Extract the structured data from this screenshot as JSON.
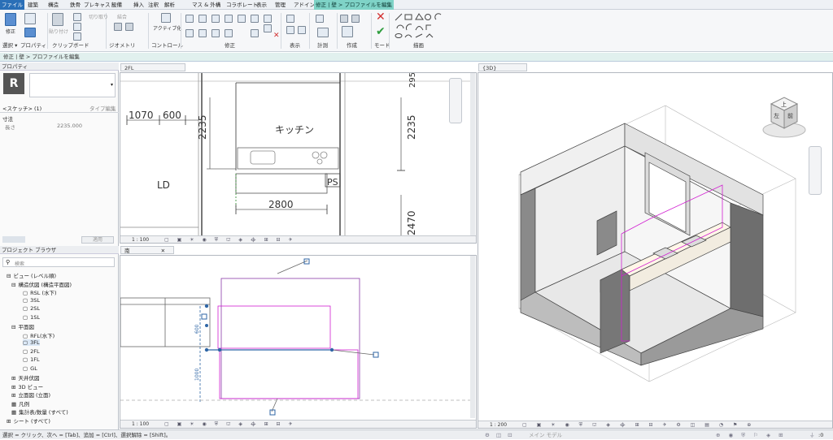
{
  "tabs": [
    "ファイル",
    "建築",
    "構造",
    "鉄骨",
    "プレキャスト",
    "設備",
    "挿入",
    "注釈",
    "解析",
    "マス & 外構",
    "コラボレート",
    "表示",
    "管理",
    "アドイン",
    "修正 | 壁 > プロファイルを編集"
  ],
  "ribbon": {
    "modify_label": "修正",
    "select_label": "選択 ▾",
    "properties_label": "プロパティ",
    "clipboard_label": "クリップボード",
    "geometry_label": "ジオメトリ",
    "control_label": "コントロール",
    "activate_label": "アクティブ化",
    "modify_group_label": "修正",
    "view_label": "表示",
    "measure_label": "計測",
    "create_label": "作成",
    "mode_label": "モード",
    "draw_label": "描画",
    "paste_label": "貼り付け",
    "cut_label": "切り取り",
    "join_label": "結合"
  },
  "optbar": {
    "text": "修正 | 壁 > プロファイルを編集"
  },
  "properties": {
    "title": "プロパティ",
    "type_name": "<スケッチ> (1)",
    "edit_type": "タイプ編集",
    "section": "寸法",
    "param_name": "長さ",
    "param_value": "2235.000",
    "apply": "適用"
  },
  "browser": {
    "title": "プロジェクト ブラウザ",
    "search_placeholder": "検索",
    "items": [
      {
        "label": "ビュー (レベル順)"
      },
      {
        "label": "構造伏図 (構造平面図)"
      },
      {
        "label": "RSL (水下)"
      },
      {
        "label": "3SL"
      },
      {
        "label": "2SL"
      },
      {
        "label": "1SL"
      },
      {
        "label": "平面図"
      },
      {
        "label": "RFL(水下)"
      },
      {
        "label": "3FL"
      },
      {
        "label": "2FL"
      },
      {
        "label": "1FL"
      },
      {
        "label": "GL"
      },
      {
        "label": "天井伏図"
      },
      {
        "label": "3D ビュー"
      },
      {
        "label": "立面図 (立面)"
      },
      {
        "label": "凡例"
      },
      {
        "label": "集計表/数量 (すべて)"
      },
      {
        "label": "シート (すべて)"
      }
    ]
  },
  "views": {
    "plan_tab": "2FL",
    "plan_scale": "1 : 100",
    "elev_tab": "南",
    "elev_scale": "1 : 100",
    "threed_tab": "{3D}",
    "threed_scale": "1 : 200"
  },
  "plan": {
    "dims": [
      "1070",
      "600",
      "2235",
      "2235",
      "2800",
      "2470",
      "295",
      "295"
    ],
    "room_kitchen": "キッチン",
    "room_ld": "LD",
    "room_ps": "PS"
  },
  "elev": {
    "dims": [
      "600",
      "1000"
    ]
  },
  "viewcube": {
    "top": "上",
    "front": "前",
    "left": "左"
  },
  "status": {
    "hint": "選択 = クリック、次へ = [Tab]、追加 = [Ctrl]、選択解除 = [Shift]。",
    "model": "メイン モデル",
    "filter": ":0"
  },
  "colors": {
    "accent": "#2a6fb7",
    "context_tab": "#7fd3c7",
    "sketch": "#d11fd1",
    "cancel": "#d32f2f",
    "finish": "#2e9e3e"
  }
}
